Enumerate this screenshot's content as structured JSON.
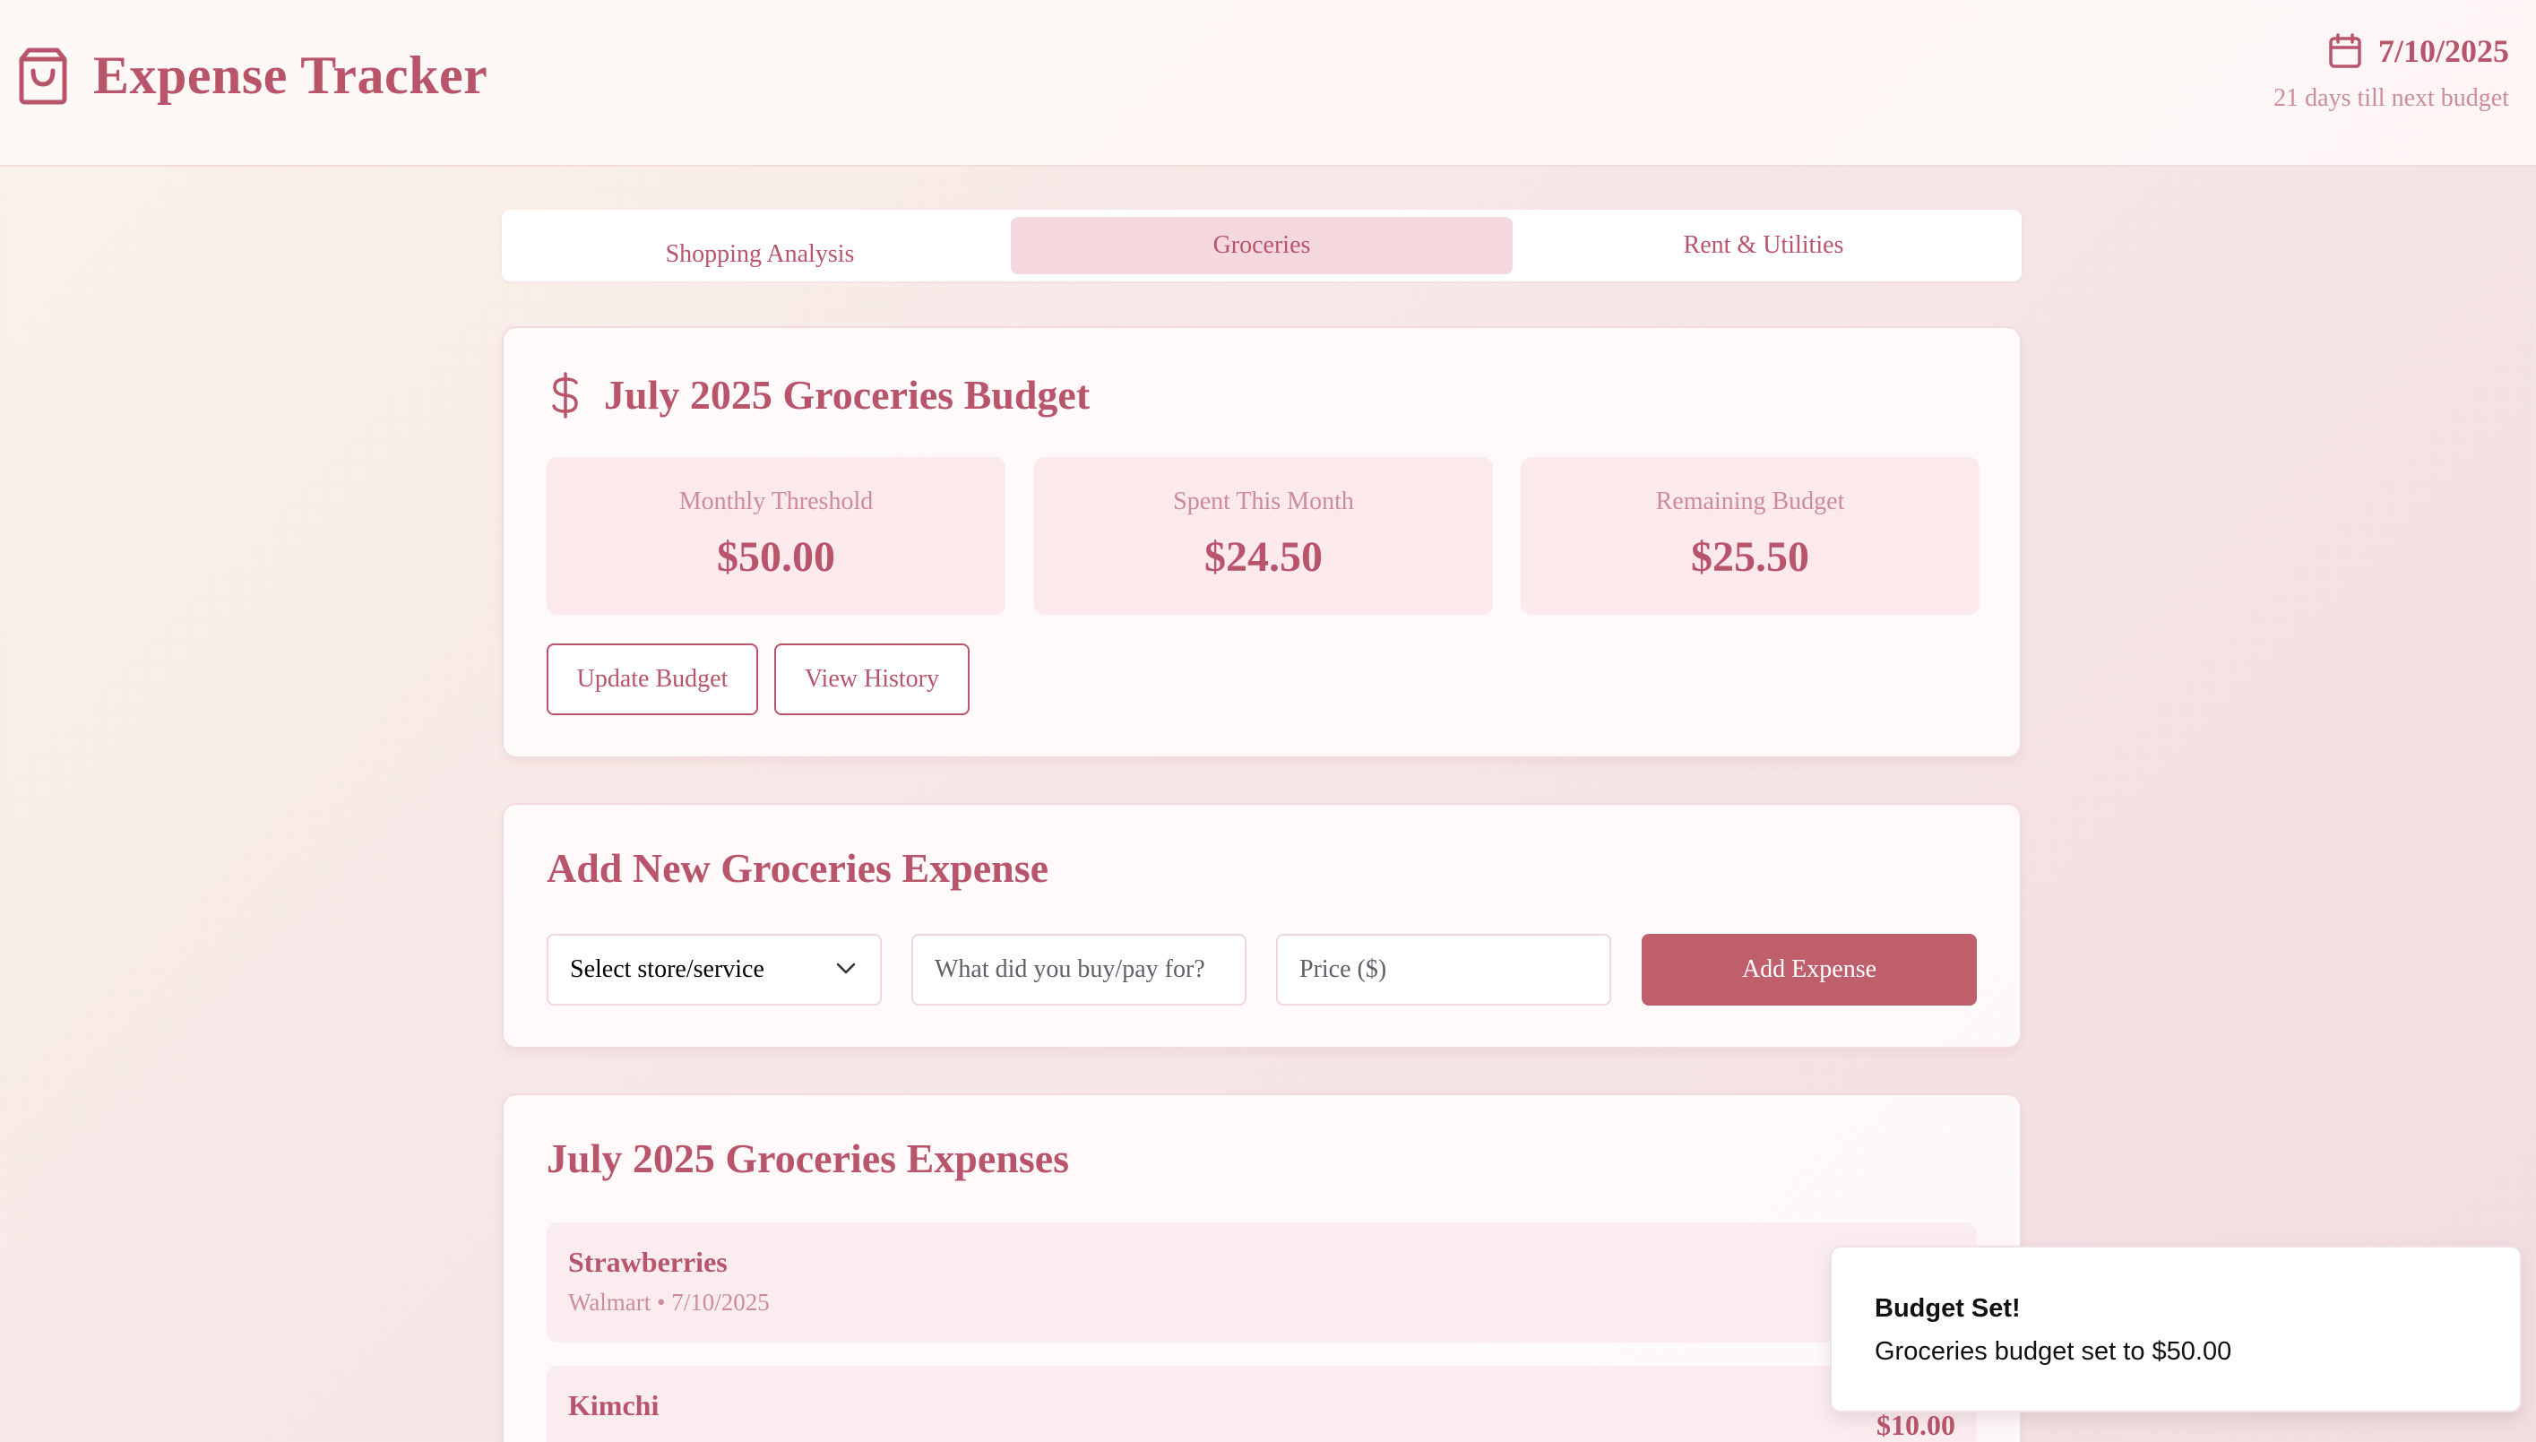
{
  "header": {
    "app_title": "Expense Tracker",
    "date": "7/10/2025",
    "days_till_budget": "21 days till next budget",
    "logo_icon": "shopping-bag-icon",
    "date_icon": "calendar-icon"
  },
  "tabs": [
    {
      "label": "Shopping Analysis",
      "active": false
    },
    {
      "label": "Groceries",
      "active": true
    },
    {
      "label": "Rent & Utilities",
      "active": false
    }
  ],
  "budget": {
    "title": "July 2025 Groceries Budget",
    "icon": "dollar-sign-icon",
    "stats": [
      {
        "label": "Monthly Threshold",
        "value": "$50.00"
      },
      {
        "label": "Spent This Month",
        "value": "$24.50"
      },
      {
        "label": "Remaining Budget",
        "value": "$25.50"
      }
    ],
    "update_label": "Update Budget",
    "history_label": "View History"
  },
  "add_expense": {
    "title": "Add New Groceries Expense",
    "store_select_value": "Select store/service",
    "description_placeholder": "What did you buy/pay for?",
    "price_placeholder": "Price ($)",
    "submit_label": "Add Expense"
  },
  "expenses": {
    "title": "July 2025 Groceries Expenses",
    "items": [
      {
        "name": "Strawberries",
        "meta": "Walmart • 7/10/2025",
        "price": ""
      },
      {
        "name": "Kimchi",
        "meta": "",
        "price": "$10.00"
      }
    ]
  },
  "toast": {
    "title": "Budget Set!",
    "description": "Groceries budget set to $50.00"
  },
  "colors": {
    "accent": "#b9556a",
    "button": "#c05f6c",
    "muted": "#cc8c98",
    "card_bg": "#fbe9ec"
  }
}
